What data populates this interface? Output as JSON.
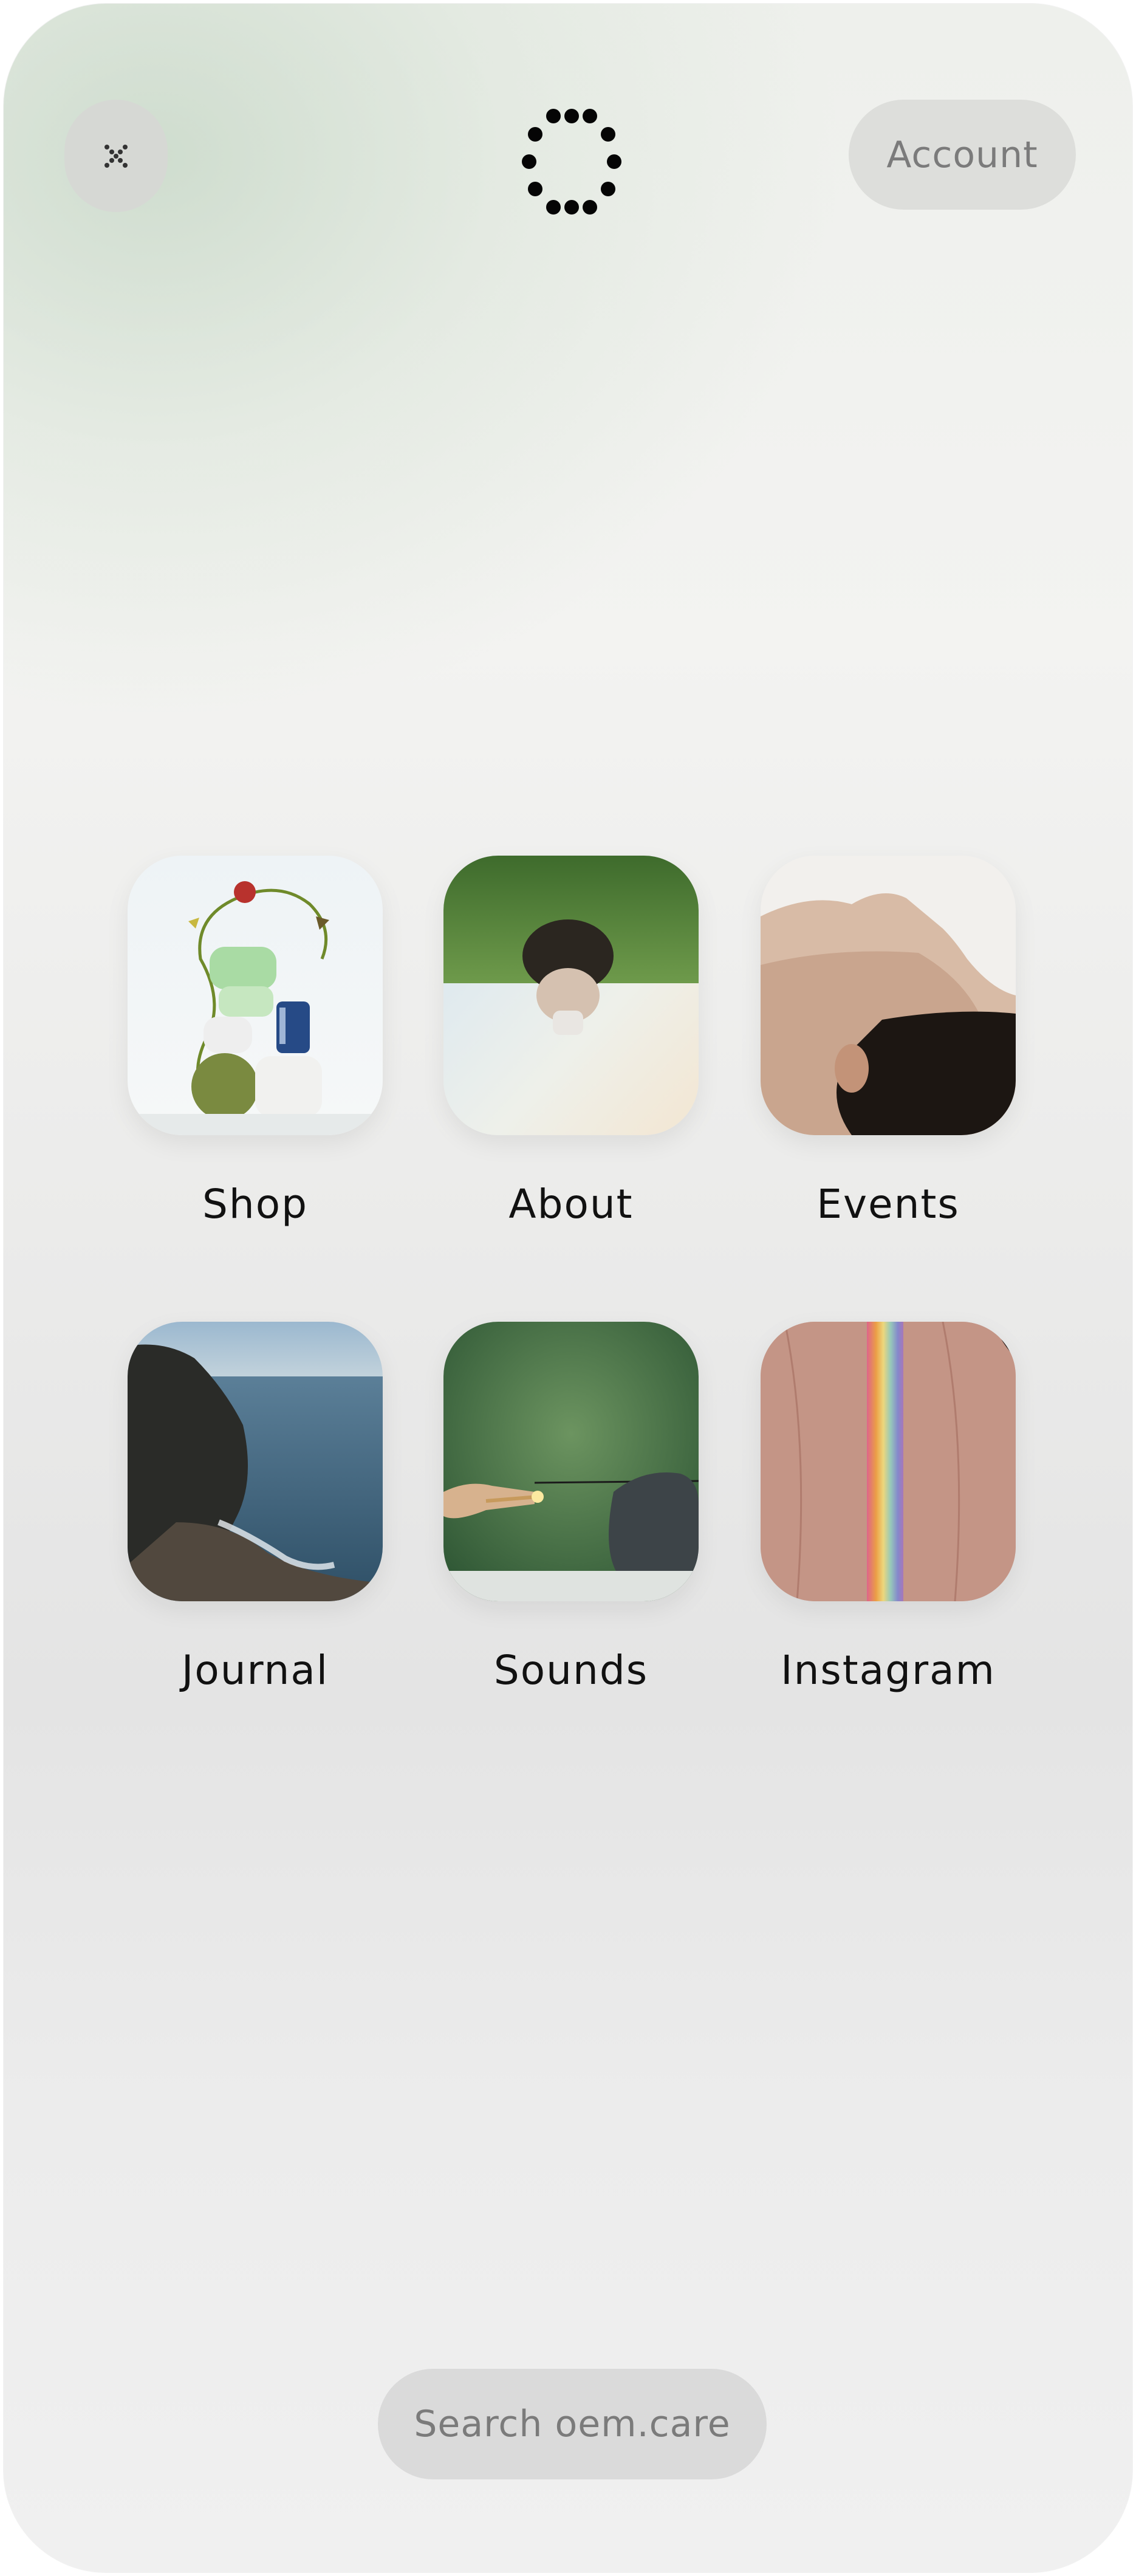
{
  "header": {
    "account_label": "Account",
    "close_icon": "close-x-icon",
    "logo_icon": "dotted-square-logo-icon"
  },
  "tiles": [
    {
      "label": "Shop",
      "image": "product-sculpture"
    },
    {
      "label": "About",
      "image": "upside-down-person-in-grass"
    },
    {
      "label": "Events",
      "image": "face-profile"
    },
    {
      "label": "Journal",
      "image": "ocean-cliff"
    },
    {
      "label": "Sounds",
      "image": "lighting-incense-match"
    },
    {
      "label": "Instagram",
      "image": "rainbow-light-on-skin"
    }
  ],
  "search": {
    "label": "Search oem.care"
  }
}
